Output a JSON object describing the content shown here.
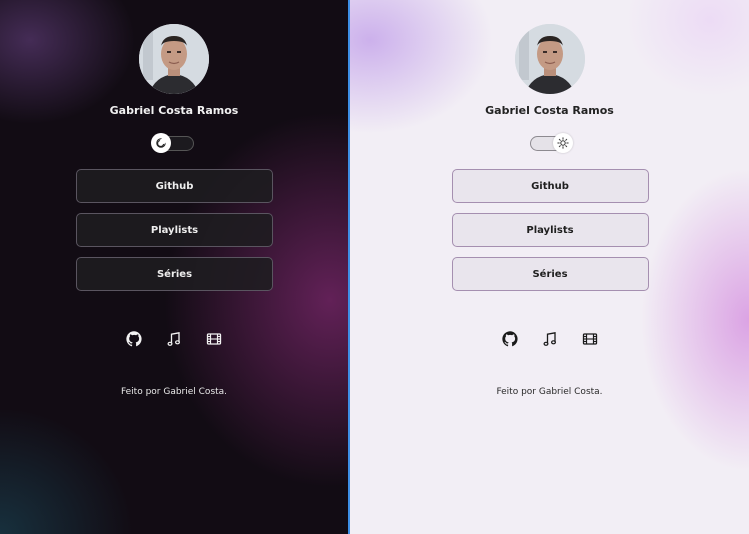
{
  "profile": {
    "name": "Gabriel Costa Ramos",
    "avatar_icon": "profile-photo"
  },
  "theme_toggle": {
    "dark_state_icon": "moon-icon",
    "light_state_icon": "sun-icon"
  },
  "buttons": {
    "github": "Github",
    "playlists": "Playlists",
    "series": "Séries"
  },
  "socials": [
    "github-icon",
    "music-note-icon",
    "film-icon"
  ],
  "footer": "Feito por Gabriel Costa.",
  "colors": {
    "dark_bg": "#120c14",
    "dark_accent": "#7d286e",
    "light_bg": "#f2eef5",
    "light_accent": "#d796e1",
    "divider": "#3d8fe6"
  }
}
